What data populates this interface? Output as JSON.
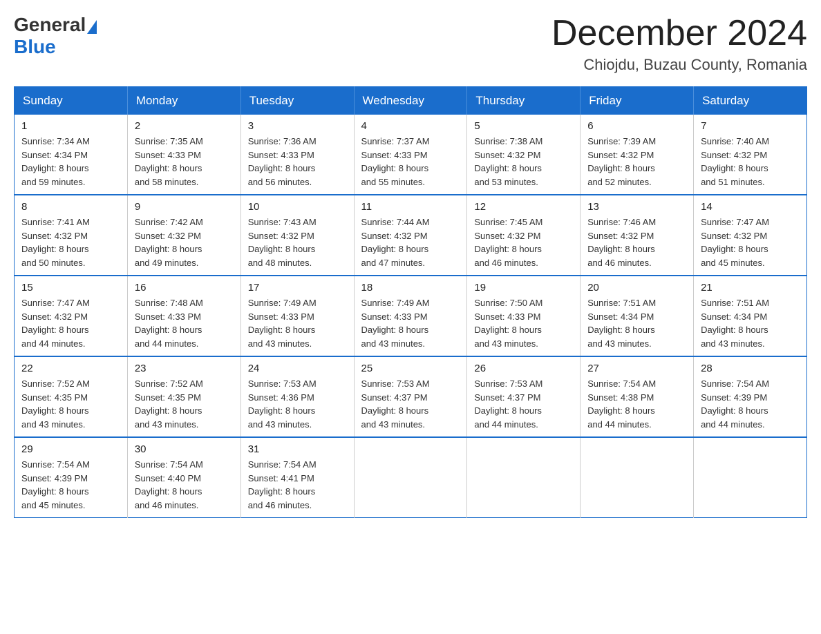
{
  "header": {
    "logo_general": "General",
    "logo_blue": "Blue",
    "month_title": "December 2024",
    "location": "Chiojdu, Buzau County, Romania"
  },
  "weekdays": [
    "Sunday",
    "Monday",
    "Tuesday",
    "Wednesday",
    "Thursday",
    "Friday",
    "Saturday"
  ],
  "weeks": [
    [
      {
        "day": "1",
        "sunrise": "7:34 AM",
        "sunset": "4:34 PM",
        "daylight": "8 hours and 59 minutes."
      },
      {
        "day": "2",
        "sunrise": "7:35 AM",
        "sunset": "4:33 PM",
        "daylight": "8 hours and 58 minutes."
      },
      {
        "day": "3",
        "sunrise": "7:36 AM",
        "sunset": "4:33 PM",
        "daylight": "8 hours and 56 minutes."
      },
      {
        "day": "4",
        "sunrise": "7:37 AM",
        "sunset": "4:33 PM",
        "daylight": "8 hours and 55 minutes."
      },
      {
        "day": "5",
        "sunrise": "7:38 AM",
        "sunset": "4:32 PM",
        "daylight": "8 hours and 53 minutes."
      },
      {
        "day": "6",
        "sunrise": "7:39 AM",
        "sunset": "4:32 PM",
        "daylight": "8 hours and 52 minutes."
      },
      {
        "day": "7",
        "sunrise": "7:40 AM",
        "sunset": "4:32 PM",
        "daylight": "8 hours and 51 minutes."
      }
    ],
    [
      {
        "day": "8",
        "sunrise": "7:41 AM",
        "sunset": "4:32 PM",
        "daylight": "8 hours and 50 minutes."
      },
      {
        "day": "9",
        "sunrise": "7:42 AM",
        "sunset": "4:32 PM",
        "daylight": "8 hours and 49 minutes."
      },
      {
        "day": "10",
        "sunrise": "7:43 AM",
        "sunset": "4:32 PM",
        "daylight": "8 hours and 48 minutes."
      },
      {
        "day": "11",
        "sunrise": "7:44 AM",
        "sunset": "4:32 PM",
        "daylight": "8 hours and 47 minutes."
      },
      {
        "day": "12",
        "sunrise": "7:45 AM",
        "sunset": "4:32 PM",
        "daylight": "8 hours and 46 minutes."
      },
      {
        "day": "13",
        "sunrise": "7:46 AM",
        "sunset": "4:32 PM",
        "daylight": "8 hours and 46 minutes."
      },
      {
        "day": "14",
        "sunrise": "7:47 AM",
        "sunset": "4:32 PM",
        "daylight": "8 hours and 45 minutes."
      }
    ],
    [
      {
        "day": "15",
        "sunrise": "7:47 AM",
        "sunset": "4:32 PM",
        "daylight": "8 hours and 44 minutes."
      },
      {
        "day": "16",
        "sunrise": "7:48 AM",
        "sunset": "4:33 PM",
        "daylight": "8 hours and 44 minutes."
      },
      {
        "day": "17",
        "sunrise": "7:49 AM",
        "sunset": "4:33 PM",
        "daylight": "8 hours and 43 minutes."
      },
      {
        "day": "18",
        "sunrise": "7:49 AM",
        "sunset": "4:33 PM",
        "daylight": "8 hours and 43 minutes."
      },
      {
        "day": "19",
        "sunrise": "7:50 AM",
        "sunset": "4:33 PM",
        "daylight": "8 hours and 43 minutes."
      },
      {
        "day": "20",
        "sunrise": "7:51 AM",
        "sunset": "4:34 PM",
        "daylight": "8 hours and 43 minutes."
      },
      {
        "day": "21",
        "sunrise": "7:51 AM",
        "sunset": "4:34 PM",
        "daylight": "8 hours and 43 minutes."
      }
    ],
    [
      {
        "day": "22",
        "sunrise": "7:52 AM",
        "sunset": "4:35 PM",
        "daylight": "8 hours and 43 minutes."
      },
      {
        "day": "23",
        "sunrise": "7:52 AM",
        "sunset": "4:35 PM",
        "daylight": "8 hours and 43 minutes."
      },
      {
        "day": "24",
        "sunrise": "7:53 AM",
        "sunset": "4:36 PM",
        "daylight": "8 hours and 43 minutes."
      },
      {
        "day": "25",
        "sunrise": "7:53 AM",
        "sunset": "4:37 PM",
        "daylight": "8 hours and 43 minutes."
      },
      {
        "day": "26",
        "sunrise": "7:53 AM",
        "sunset": "4:37 PM",
        "daylight": "8 hours and 44 minutes."
      },
      {
        "day": "27",
        "sunrise": "7:54 AM",
        "sunset": "4:38 PM",
        "daylight": "8 hours and 44 minutes."
      },
      {
        "day": "28",
        "sunrise": "7:54 AM",
        "sunset": "4:39 PM",
        "daylight": "8 hours and 44 minutes."
      }
    ],
    [
      {
        "day": "29",
        "sunrise": "7:54 AM",
        "sunset": "4:39 PM",
        "daylight": "8 hours and 45 minutes."
      },
      {
        "day": "30",
        "sunrise": "7:54 AM",
        "sunset": "4:40 PM",
        "daylight": "8 hours and 46 minutes."
      },
      {
        "day": "31",
        "sunrise": "7:54 AM",
        "sunset": "4:41 PM",
        "daylight": "8 hours and 46 minutes."
      },
      null,
      null,
      null,
      null
    ]
  ],
  "labels": {
    "sunrise": "Sunrise:",
    "sunset": "Sunset:",
    "daylight": "Daylight:"
  }
}
